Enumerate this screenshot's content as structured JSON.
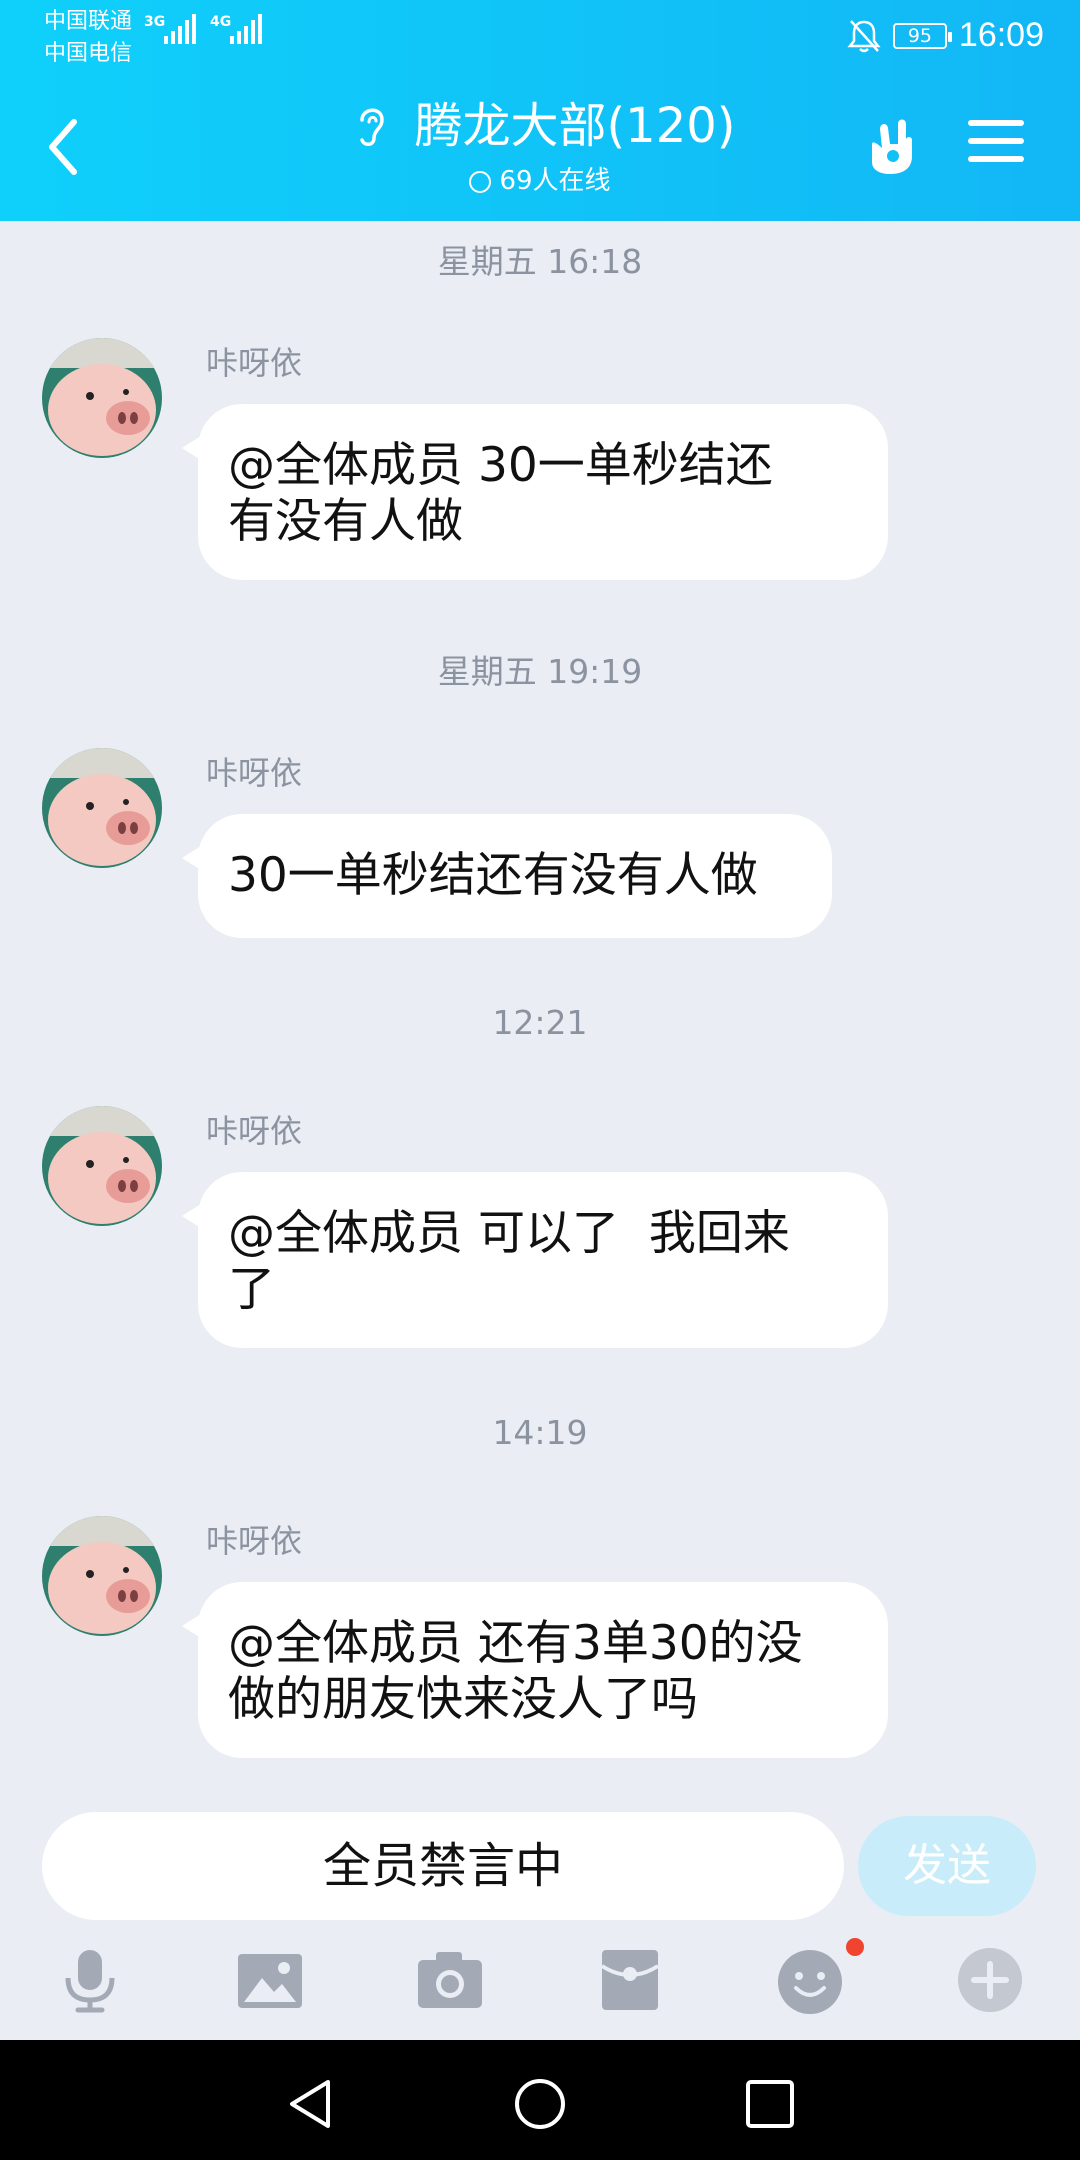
{
  "status_bar": {
    "carrier1": "中国联通",
    "carrier2": "中国电信",
    "net1": "3G",
    "net2": "4G",
    "battery": "95",
    "time": "16:09"
  },
  "header": {
    "title": "腾龙大部(120)",
    "online": "69人在线"
  },
  "messages": [
    {
      "timestamp": "星期五 16:18",
      "sender": "咔呀依",
      "text_lines": [
        "@全体成员 30一单秒结还",
        "有没有人做"
      ]
    },
    {
      "timestamp": "星期五 19:19",
      "sender": "咔呀依",
      "text_lines": [
        "30一单秒结还有没有人做"
      ]
    },
    {
      "timestamp": "12:21",
      "sender": "咔呀依",
      "text_lines": [
        "@全体成员 可以了  我回来",
        "了"
      ]
    },
    {
      "timestamp": "14:19",
      "sender": "咔呀依",
      "text_lines": [
        "@全体成员 还有3单30的没",
        "做的朋友快来没人了吗"
      ]
    }
  ],
  "input": {
    "muted_text": "全员禁言中",
    "send_label": "发送"
  },
  "colors": {
    "header_start": "#0fd0fb",
    "header_end": "#12b7f5",
    "background": "#eaedf4",
    "send_disabled": "#c9ecfa",
    "notification_dot": "#f0442f"
  },
  "icons": [
    "back-arrow-icon",
    "ear-icon",
    "hand-gesture-icon",
    "menu-icon",
    "microphone-icon",
    "image-icon",
    "camera-icon",
    "red-packet-icon",
    "emoji-icon",
    "plus-icon"
  ]
}
